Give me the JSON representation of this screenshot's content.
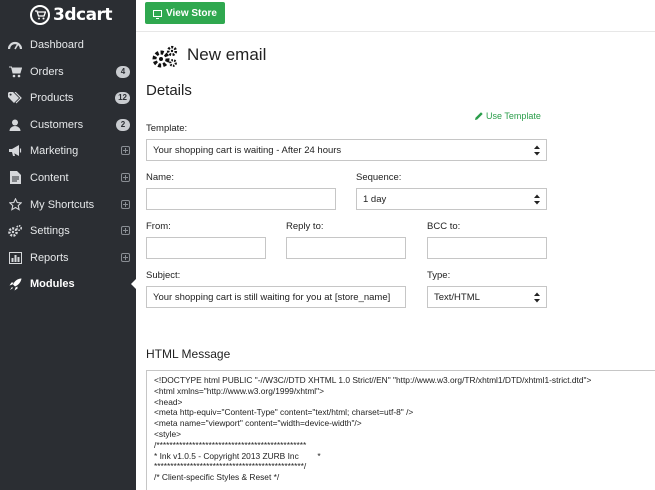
{
  "brand": {
    "name": "3dcart"
  },
  "topbar": {
    "view_store_label": "View Store"
  },
  "sidebar": {
    "items": [
      {
        "label": "Dashboard",
        "icon": "dashboard-icon"
      },
      {
        "label": "Orders",
        "icon": "cart-icon",
        "badge": "4"
      },
      {
        "label": "Products",
        "icon": "tags-icon",
        "badge": "12"
      },
      {
        "label": "Customers",
        "icon": "user-icon",
        "badge": "2"
      },
      {
        "label": "Marketing",
        "icon": "bullhorn-icon"
      },
      {
        "label": "Content",
        "icon": "file-icon"
      },
      {
        "label": "My Shortcuts",
        "icon": "star-icon"
      },
      {
        "label": "Settings",
        "icon": "cogs-icon"
      },
      {
        "label": "Reports",
        "icon": "bar-chart-icon"
      },
      {
        "label": "Modules",
        "icon": "rocket-icon",
        "active": true
      }
    ]
  },
  "page": {
    "title": "New email",
    "section": "Details",
    "use_template": "Use Template"
  },
  "form": {
    "template": {
      "label": "Template:",
      "value": "Your shopping cart is waiting - After 24 hours"
    },
    "name": {
      "label": "Name:",
      "value": ""
    },
    "sequence": {
      "label": "Sequence:",
      "value": "1 day"
    },
    "from": {
      "label": "From:",
      "value": ""
    },
    "reply_to": {
      "label": "Reply to:",
      "value": ""
    },
    "bcc_to": {
      "label": "BCC to:",
      "value": ""
    },
    "subject": {
      "label": "Subject:",
      "value": "Your shopping cart is still waiting for you at [store_name]"
    },
    "type": {
      "label": "Type:",
      "value": "Text/HTML"
    }
  },
  "html_message": {
    "heading": "HTML Message",
    "lines": [
      "<!DOCTYPE html PUBLIC \"-//W3C//DTD XHTML 1.0 Strict//EN\" \"http://www.w3.org/TR/xhtml1/DTD/xhtml1-strict.dtd\">",
      "<html xmlns=\"http://www.w3.org/1999/xhtml\">",
      "<head>",
      "<meta http-equiv=\"Content-Type\" content=\"text/html; charset=utf-8\" />",
      "<meta name=\"viewport\" content=\"width=device-width\"/>",
      "<style>",
      "/**********************************************",
      "* Ink v1.0.5 - Copyright 2013 ZURB Inc        *",
      "**********************************************/",
      "",
      "/* Client-specific Styles & Reset */"
    ]
  },
  "colors": {
    "sidebar_bg": "#2b2e33",
    "accent_green": "#2fa84f",
    "link_green": "#2a9d4a",
    "badge_bg": "#c9ccd0"
  }
}
